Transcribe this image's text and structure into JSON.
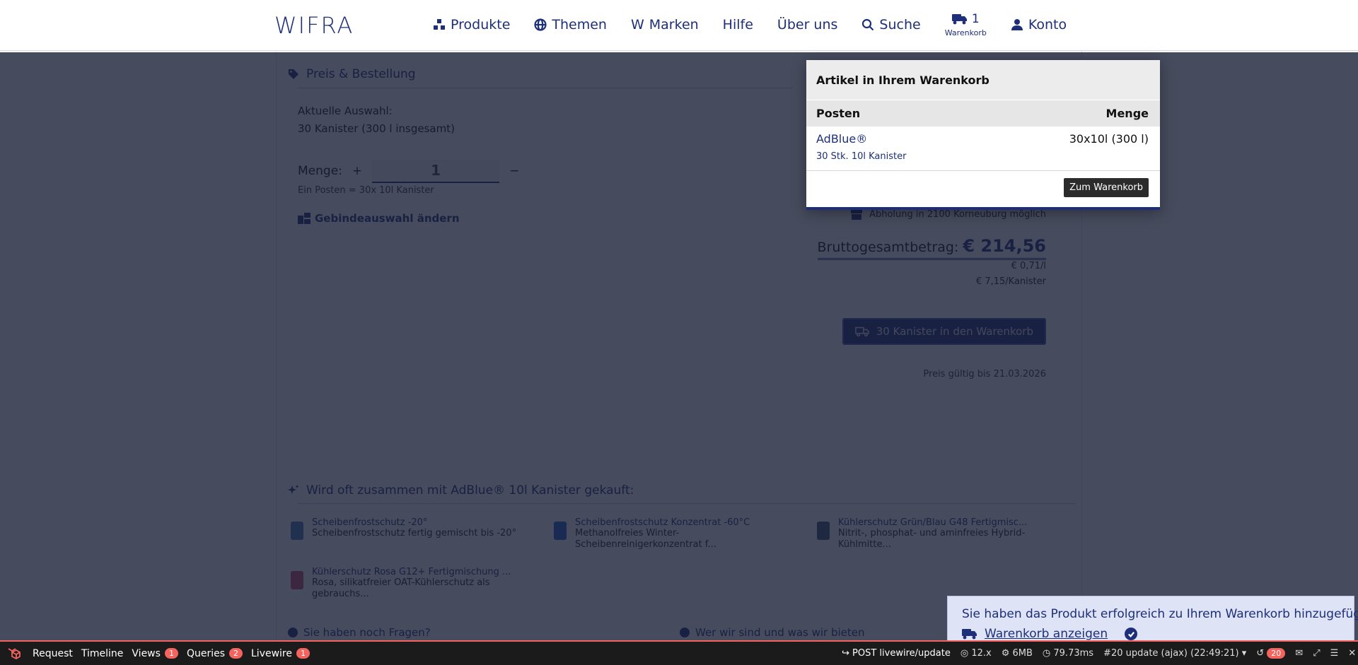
{
  "header": {
    "logo": "WIFRA",
    "nav": {
      "produkte": "Produkte",
      "themen": "Themen",
      "marken": "Marken",
      "marken_prefix": "W",
      "hilfe": "Hilfe",
      "ueber_uns": "Über uns",
      "suche": "Suche",
      "cart_count": "1",
      "cart_label": "Warenkorb",
      "konto": "Konto"
    }
  },
  "order": {
    "heading": "Preis & Bestellung",
    "current_selection_label": "Aktuelle Auswahl:",
    "current_selection_value": "30 Kanister (300 l insgesamt)",
    "quantity_label": "Menge:",
    "plus": "+",
    "minus": "−",
    "quantity_value": "1",
    "unit_note": "Ein Posten = 30x 10l Kanister",
    "change_container": "Gebindeauswahl ändern",
    "pickup": "Abholung in 2100 Korneuburg möglich",
    "total_label": "Bruttogesamtbetrag:",
    "total_amount": "€ 214,56",
    "price_per_liter": "€ 0,71/l",
    "price_per_canister": "€ 7,15/Kanister",
    "add_to_cart": "30 Kanister in den Warenkorb",
    "valid_until": "Preis gültig bis 21.03.2026"
  },
  "related": {
    "heading": "Wird oft zusammen mit AdBlue® 10l Kanister gekauft:",
    "items": [
      {
        "name": "Scheibenfrostschutz -20°",
        "desc": "Scheibenfrostschutz fertig gemischt bis -20°",
        "color": "#3f7fb8"
      },
      {
        "name": "Scheibenfrostschutz Konzentrat -60°C",
        "desc": "Methanolfreies Winter-Scheibenreinigerkonzentrat f...",
        "color": "#1e5fc9"
      },
      {
        "name": "Kühlerschutz Grün/Blau G48 Fertigmisc...",
        "desc": "Nitrit-, phosphat- und aminfreies Hybrid-Kühlmitte...",
        "color": "#3a4f6e"
      },
      {
        "name": "Kühlerschutz Rosa G12+ Fertigmischung ...",
        "desc": "Rosa, silikatfreier OAT-Kühlerschutz als gebrauchs...",
        "color": "#c94b6a"
      }
    ]
  },
  "footer": {
    "questions": "Sie haben noch Fragen?",
    "about": "Wer wir sind und was wir bieten"
  },
  "cart_popup": {
    "title": "Artikel in Ihrem Warenkorb",
    "col_item": "Posten",
    "col_qty": "Menge",
    "item_name": "AdBlue®",
    "item_sub": "30 Stk. 10l Kanister",
    "item_qty": "30x10l (300 l)",
    "goto_cart": "Zum Warenkorb"
  },
  "toast": {
    "message": "Sie haben das Produkt erfolgreich zu Ihrem Warenkorb hinzugefügt.",
    "link": "Warenkorb anzeigen"
  },
  "debugbar": {
    "tabs": [
      {
        "label": "Request",
        "badge": ""
      },
      {
        "label": "Timeline",
        "badge": ""
      },
      {
        "label": "Views",
        "badge": "1"
      },
      {
        "label": "Queries",
        "badge": "2"
      },
      {
        "label": "Livewire",
        "badge": "1"
      }
    ],
    "request": "POST livewire/update",
    "php": "12.x",
    "memory": "6MB",
    "time": "79.73ms",
    "update": "#20 update (ajax) (22:49:21)",
    "history_count": "20"
  }
}
